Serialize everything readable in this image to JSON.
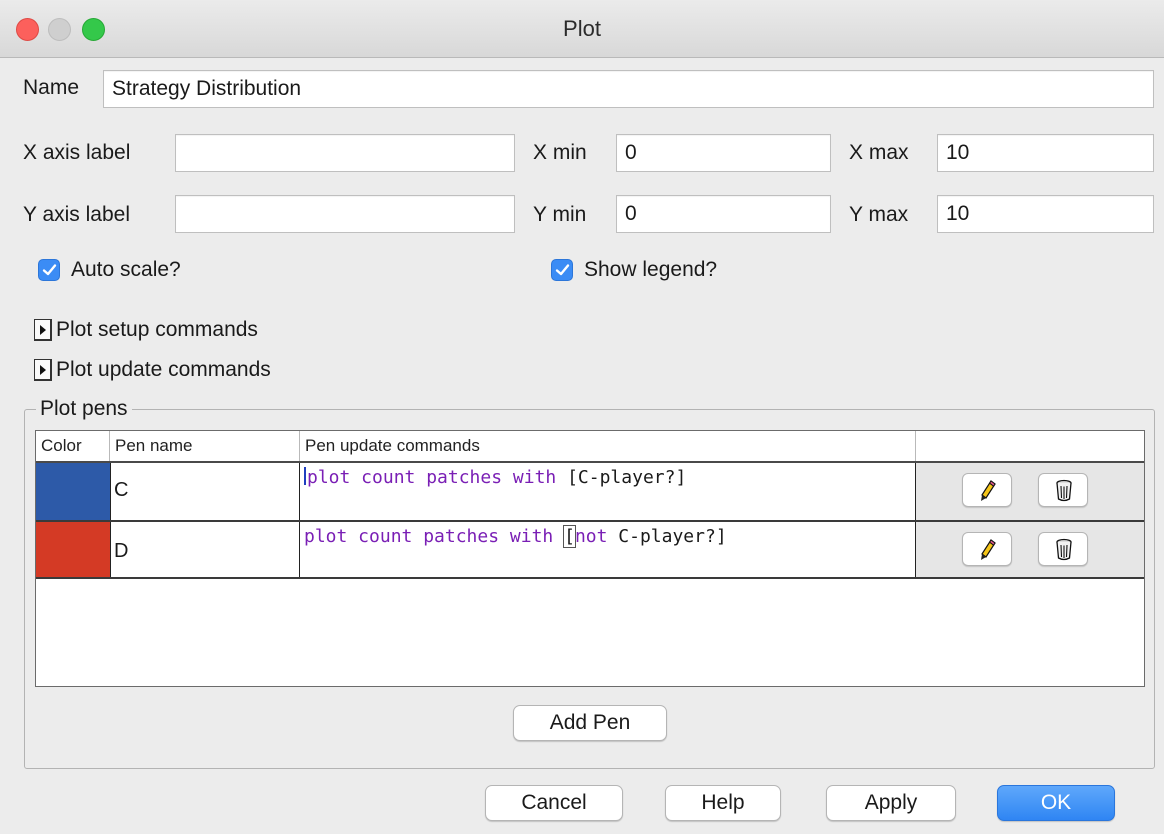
{
  "window": {
    "title": "Plot"
  },
  "name": {
    "label": "Name",
    "value": "Strategy Distribution"
  },
  "x_axis": {
    "label": "X axis label",
    "value": "",
    "min_label": "X min",
    "min_value": "0",
    "max_label": "X max",
    "max_value": "10"
  },
  "y_axis": {
    "label": "Y axis label",
    "value": "",
    "min_label": "Y min",
    "min_value": "0",
    "max_label": "Y max",
    "max_value": "10"
  },
  "auto_scale": {
    "label": "Auto scale?",
    "checked": true
  },
  "show_legend": {
    "label": "Show legend?",
    "checked": true
  },
  "setup_commands": {
    "label": "Plot setup commands"
  },
  "update_commands": {
    "label": "Plot update commands"
  },
  "pens": {
    "group_title": "Plot pens",
    "columns": [
      "Color",
      "Pen name",
      "Pen update commands"
    ],
    "rows": [
      {
        "color": "#2d5aa8",
        "name": "C",
        "cmd_keyword": "plot count patches with",
        "cmd_rest": " [C-player?]"
      },
      {
        "color": "#d43a25",
        "name": "D",
        "cmd_keyword": "plot count patches with",
        "cmd_bracket": "[",
        "cmd_not": "not",
        "cmd_rest": " C-player?]"
      }
    ],
    "edit_icon": "pencil-icon",
    "delete_icon": "trash-icon",
    "add_pen_label": "Add Pen"
  },
  "buttons": {
    "cancel": "Cancel",
    "help": "Help",
    "apply": "Apply",
    "ok": "OK"
  },
  "colors": {
    "accent": "#3b8cf5",
    "keyword": "#7a1fb5"
  }
}
